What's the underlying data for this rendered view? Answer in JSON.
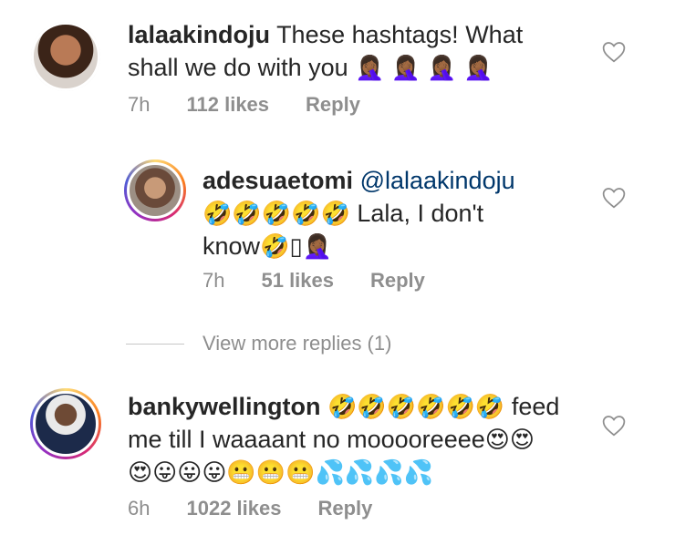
{
  "comments": [
    {
      "username": "lalaakindoju",
      "text_line1": "These hashtags! What",
      "text_line2": "shall we do with you",
      "emojis_line2": "🤦🏾‍♀️ 🤦🏾‍♀️ 🤦🏾‍♀️ 🤦🏾‍♀️",
      "time": "7h",
      "likes": "112 likes",
      "reply": "Reply"
    },
    {
      "username": "adesuaetomi",
      "mention": "@lalaakindoju",
      "emojis_line2": "🤣🤣🤣🤣🤣",
      "text_line2": "Lala, I don't",
      "text_line3": "know",
      "emojis_line3": "🤣▯🤦🏾‍♀️",
      "time": "7h",
      "likes": "51 likes",
      "reply": "Reply"
    },
    {
      "username": "bankywellington",
      "emojis_line1": "🤣🤣🤣🤣🤣🤣",
      "text_line1": "feed",
      "text_line2": "me till I waaaant no mooooreeee",
      "emojis_line2": "😍😍",
      "emojis_line3": "😍😛😛😛😬😬😬💦💦💦💦",
      "time": "6h",
      "likes": "1022 likes",
      "reply": "Reply"
    }
  ],
  "view_more": "View more replies (1)",
  "icons": {
    "heart": "heart-outline-icon"
  },
  "colors": {
    "text": "#262626",
    "muted": "#8e8e8e",
    "mention": "#00376b"
  }
}
